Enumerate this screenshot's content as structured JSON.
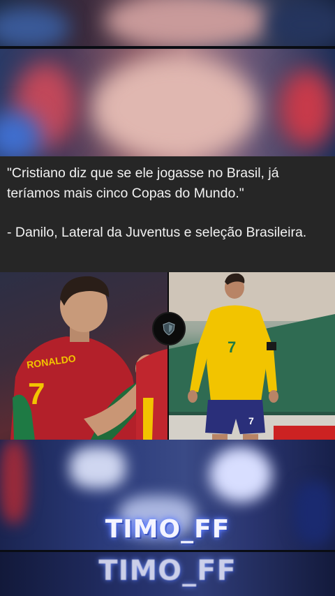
{
  "quote": {
    "text": "\"Cristiano diz que se ele jogasse no Brasil, já teríamos mais cinco Copas do Mundo.\"",
    "author": "- Danilo, Lateral da Juventus e seleção Brasileira."
  },
  "photos": {
    "left_jersey_name": "RONALDO",
    "left_jersey_number": "7",
    "right_jersey_number": "7",
    "right_shorts_number": "7"
  },
  "overlay": {
    "username_top": "TIMO_FF",
    "username_bottom": "TIMO_FF"
  },
  "colors": {
    "quote_background": "#262626",
    "portugal_red": "#b3202a",
    "brazil_yellow": "#f2c400",
    "brazil_blue": "#2a2f7a"
  }
}
